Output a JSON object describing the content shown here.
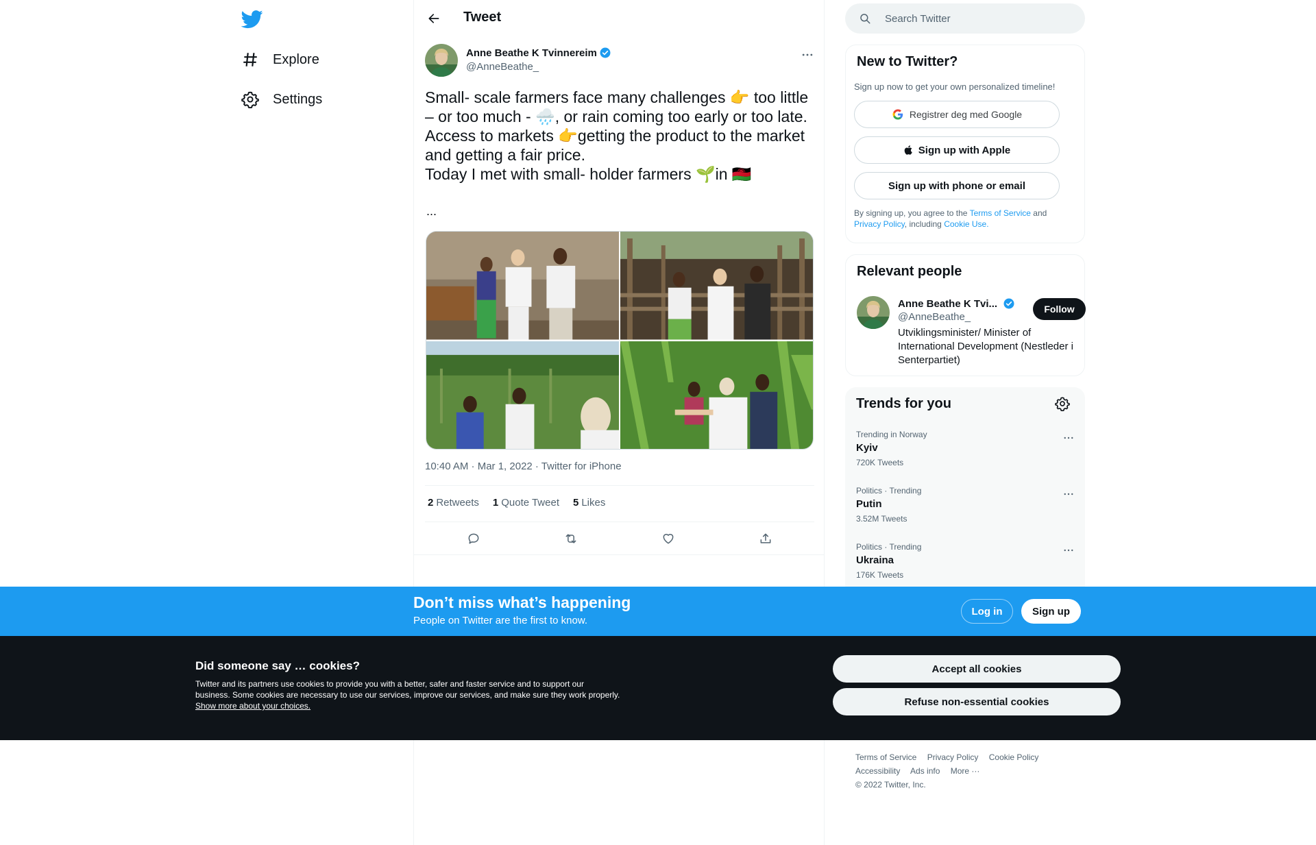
{
  "nav": {
    "logo": "twitter-bird-icon",
    "items": [
      {
        "label": "Explore",
        "icon": "hashtag-icon"
      },
      {
        "label": "Settings",
        "icon": "gear-icon"
      }
    ]
  },
  "header": {
    "title": "Tweet"
  },
  "tweet": {
    "author_name": "Anne Beathe K Tvinnereim",
    "author_handle": "@AnneBeathe_",
    "text": "Small- scale farmers face many challenges 👉 too little – or too much - 🌧️, or rain coming too early or too late.\nAccess to markets 👉getting the product to the market and getting a fair price.\nToday I met with small- holder farmers 🌱in 🇲🇼",
    "ellipsis": "...",
    "timestamp": "10:40 AM · Mar 1, 2022 · Twitter for iPhone",
    "stats": [
      {
        "count": "2",
        "label": "Retweets"
      },
      {
        "count": "1",
        "label": "Quote Tweet"
      },
      {
        "count": "5",
        "label": "Likes"
      }
    ],
    "actions": [
      "reply-icon",
      "retweet-icon",
      "like-icon",
      "share-icon"
    ]
  },
  "search": {
    "placeholder": "Search Twitter"
  },
  "signup_card": {
    "title": "New to Twitter?",
    "subtitle": "Sign up now to get your own personalized timeline!",
    "google_label": "Registrer deg med Google",
    "apple_label": "Sign up with Apple",
    "phone_label": "Sign up with phone or email",
    "terms_prefix": "By signing up, you agree to the",
    "terms_link": "Terms of Service",
    "terms_and": "and",
    "privacy_link": "Privacy Policy",
    "terms_including": ", including",
    "cookie_link": "Cookie Use."
  },
  "relevant": {
    "title": "Relevant people",
    "name": "Anne Beathe K Tvi...",
    "handle": "@AnneBeathe_",
    "bio": "Utviklingsminister/ Minister of International Development (Nestleder i Senterpartiet)",
    "follow_label": "Follow"
  },
  "trends": {
    "title": "Trends for you",
    "items": [
      {
        "context": "Trending in Norway",
        "name": "Kyiv",
        "count": "720K Tweets"
      },
      {
        "context": "Politics · Trending",
        "name": "Putin",
        "count": "3.52M Tweets"
      },
      {
        "context": "Politics · Trending",
        "name": "Ukraina",
        "count": "176K Tweets"
      }
    ]
  },
  "footer": {
    "links_row1": [
      "Terms of Service",
      "Privacy Policy",
      "Cookie Policy"
    ],
    "links_row2": [
      "Accessibility",
      "Ads info",
      "More ···"
    ],
    "copyright": "© 2022 Twitter, Inc."
  },
  "login_bar": {
    "title": "Don’t miss what’s happening",
    "subtitle": "People on Twitter are the first to know.",
    "login_label": "Log in",
    "signup_label": "Sign up"
  },
  "cookie_bar": {
    "title": "Did someone say … cookies?",
    "body": "Twitter and its partners use cookies to provide you with a better, safer and faster service and to support our business. Some cookies are necessary to use our services, improve our services, and make sure they work properly.",
    "link": "Show more about your choices.",
    "accept_label": "Accept all cookies",
    "refuse_label": "Refuse non-essential cookies"
  },
  "colors": {
    "accent": "#1d9bf0",
    "text": "#0f1419",
    "muted": "#536471",
    "dark": "#0f1419"
  }
}
